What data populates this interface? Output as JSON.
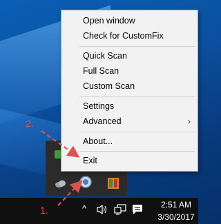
{
  "context_menu": {
    "items": [
      {
        "label": "Open window"
      },
      {
        "label": "Check for CustomFix"
      },
      {
        "label": "Quick Scan"
      },
      {
        "label": "Full Scan"
      },
      {
        "label": "Custom Scan"
      },
      {
        "label": "Settings"
      },
      {
        "label": "Advanced",
        "has_submenu": true
      },
      {
        "label": "About..."
      },
      {
        "label": "Exit"
      }
    ],
    "submenu_glyph": "›"
  },
  "annotations": {
    "step1": "1.",
    "step2": "2.",
    "color": "#d9534f"
  },
  "tray_overflow": {
    "icons": [
      {
        "name": "onedrive-icon"
      },
      {
        "name": "scanner-app-icon"
      },
      {
        "name": "avg-icon"
      }
    ]
  },
  "taskbar": {
    "show_hidden_glyph": "^",
    "clock_time": "2:51 AM",
    "clock_date": "3/30/2017"
  }
}
